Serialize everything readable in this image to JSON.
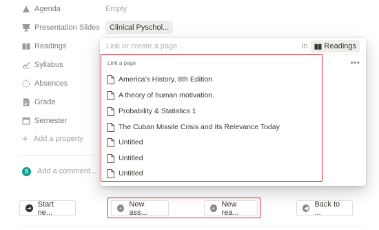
{
  "properties": [
    {
      "label": "Agenda",
      "icon": "triangle-icon",
      "value": "Empty"
    },
    {
      "label": "Presentation Slides",
      "icon": "presentation-icon",
      "value": "Clinical Pyschol..."
    },
    {
      "label": "Readings",
      "icon": "book-icon",
      "value": ""
    },
    {
      "label": "Syllabus",
      "icon": "graph-icon",
      "value": ""
    },
    {
      "label": "Absences",
      "icon": "dashed-circle-icon",
      "value": ""
    },
    {
      "label": "Grade",
      "icon": "document-icon",
      "value": ""
    },
    {
      "label": "Semester",
      "icon": "calendar-icon",
      "value": ""
    }
  ],
  "add_property": "Add a property",
  "comment_placeholder": "Add a comment...",
  "avatar_initial": "S",
  "popup": {
    "placeholder": "Link or create a page...",
    "in_label": "In",
    "database": "Readings",
    "section_title": "Link a page",
    "more": "•••",
    "pages": [
      "America's History, 8th Edition",
      "A theory of human motivation.",
      "Probability & Statistics 1",
      "The Cuban Missile Crisis and Its Relevance Today",
      "Untitled",
      "Untitled",
      "Untitled"
    ]
  },
  "buttons": {
    "start": "Start ne...",
    "new_ass": "New ass...",
    "new_rea": "New rea...",
    "back": "Back to ..."
  },
  "colors": {
    "highlight": "#d52a2e",
    "avatar": "#0f9d8a"
  }
}
